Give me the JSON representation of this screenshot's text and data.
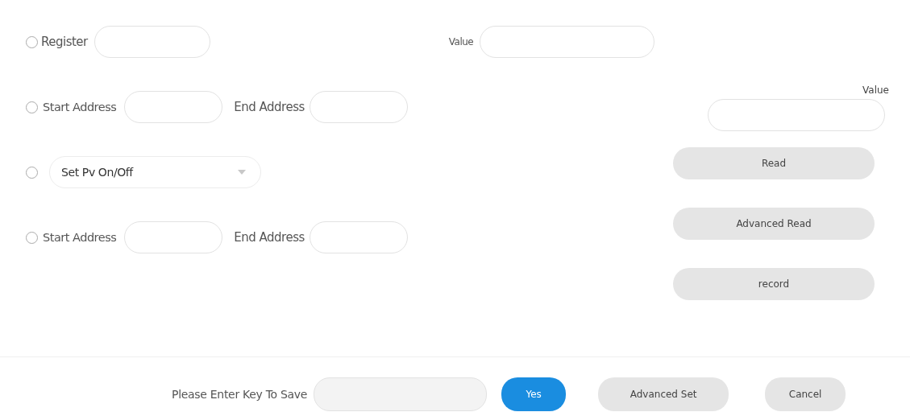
{
  "options": [
    {
      "kind": "register",
      "selected": false,
      "label": "Register",
      "value_label": "Value"
    },
    {
      "kind": "range",
      "selected": false,
      "start_label": "Start Address",
      "end_label": "End Address"
    },
    {
      "kind": "dropdown",
      "selected": false,
      "value": "Set Pv On/Off"
    },
    {
      "kind": "range",
      "selected": false,
      "start_label": "Start Address",
      "end_label": "End Address"
    }
  ],
  "read_panel": {
    "value_label": "Value",
    "buttons": [
      "Read",
      "Advanced Read",
      "record"
    ]
  },
  "footer": {
    "key_label": "Please Enter Key To Save",
    "buttons": [
      {
        "label": "Yes",
        "primary": true
      },
      {
        "label": "Advanced Set",
        "primary": false
      },
      {
        "label": "Cancel",
        "primary": false
      }
    ]
  }
}
